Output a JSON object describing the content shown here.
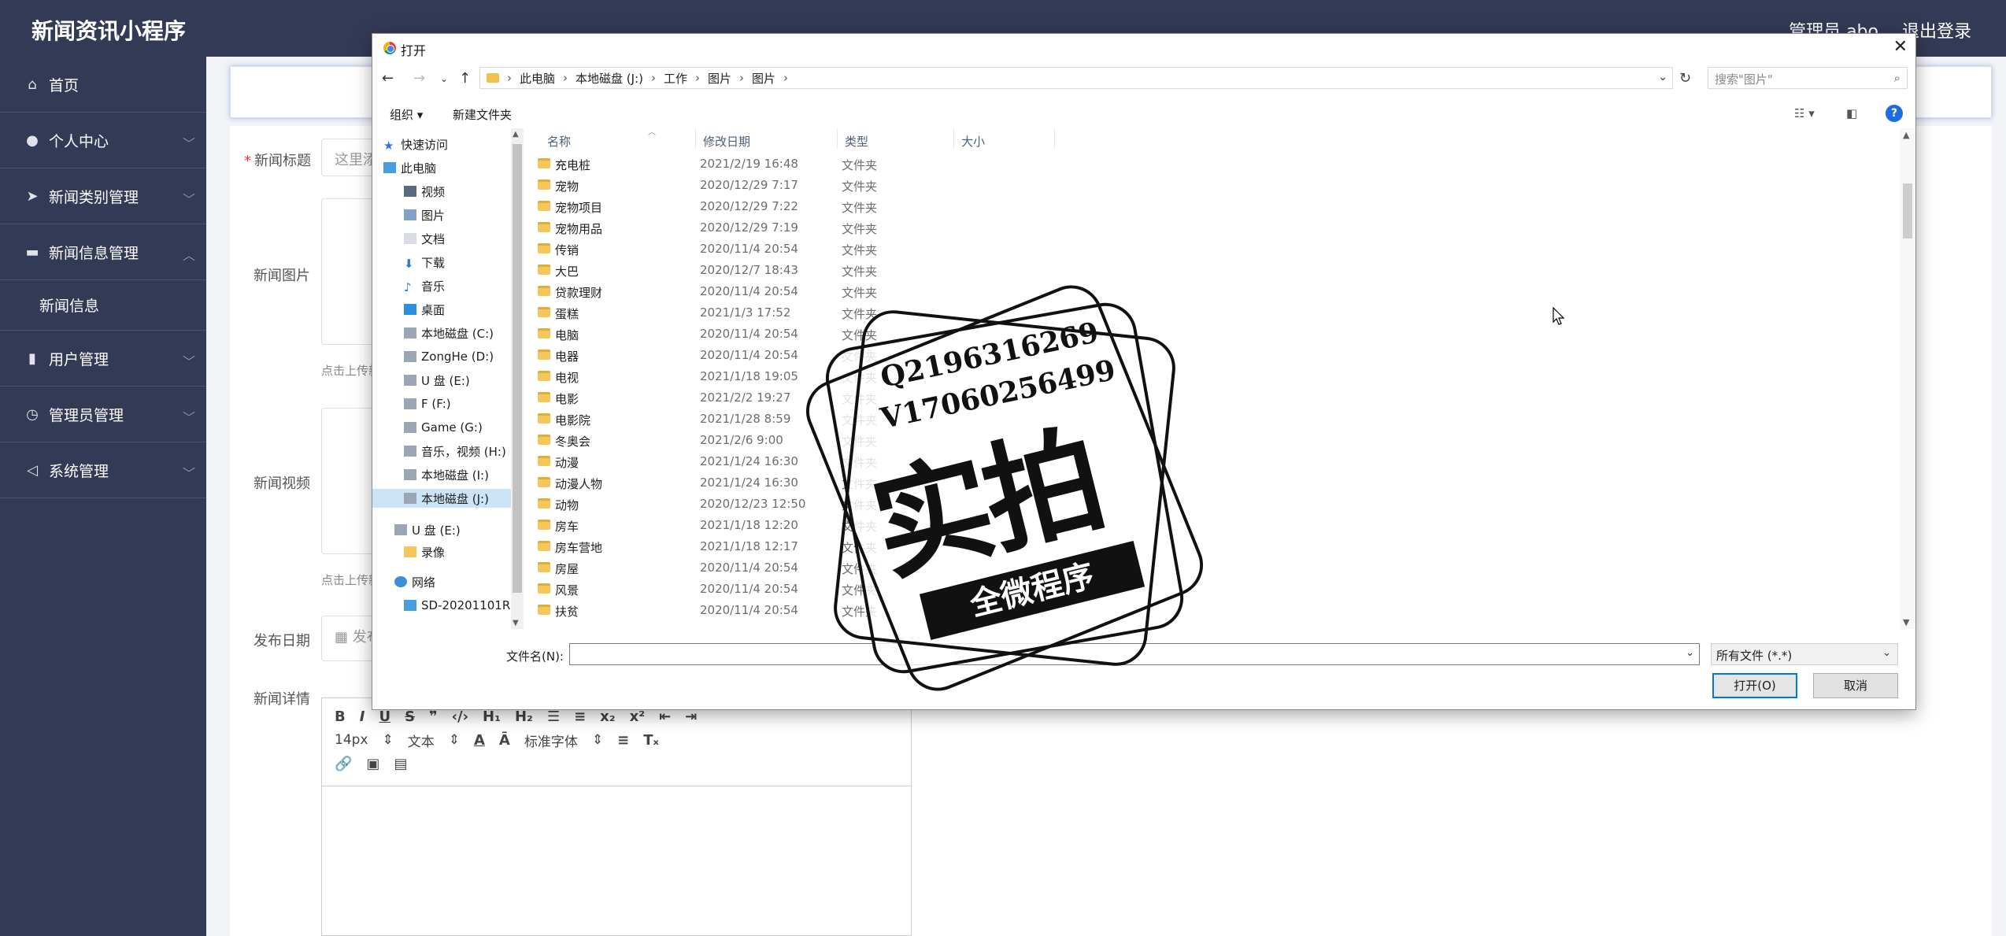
{
  "app": {
    "title": "新闻资讯小程序",
    "admin": "管理员 abo",
    "logout": "退出登录"
  },
  "sidebar": {
    "items": [
      {
        "label": "首页",
        "icon": "home-icon"
      },
      {
        "label": "个人中心",
        "icon": "user-icon"
      },
      {
        "label": "新闻类别管理",
        "icon": "send-icon"
      },
      {
        "label": "新闻信息管理",
        "icon": "monitor-icon"
      },
      {
        "label": "新闻信息",
        "icon": ""
      },
      {
        "label": "用户管理",
        "icon": "phone-icon"
      },
      {
        "label": "管理员管理",
        "icon": "clock-icon"
      },
      {
        "label": "系统管理",
        "icon": "navigate-icon"
      }
    ]
  },
  "form": {
    "title_label": "新闻标题",
    "title_placeholder": "这里添",
    "image_label": "新闻图片",
    "image_hint": "点击上传新",
    "video_label": "新闻视频",
    "video_hint": "点击上传新",
    "date_label": "发布日期",
    "date_placeholder": "发布",
    "detail_label": "新闻详情",
    "editor": {
      "font_size": "14px",
      "text_style": "文本",
      "font_family": "标准字体"
    }
  },
  "dialog": {
    "title": "打开",
    "breadcrumbs": [
      "此电脑",
      "本地磁盘 (J:)",
      "工作",
      "图片",
      "图片"
    ],
    "search_placeholder": "搜索\"图片\"",
    "toolbar": {
      "organize": "组织 ▾",
      "new_folder": "新建文件夹"
    },
    "columns": [
      "名称",
      "修改日期",
      "类型",
      "大小"
    ],
    "nav": [
      {
        "label": "快速访问",
        "icon": "star-icon",
        "indent": 0
      },
      {
        "label": "此电脑",
        "icon": "computer-icon",
        "indent": 0
      },
      {
        "label": "视频",
        "icon": "video-icon",
        "indent": 1
      },
      {
        "label": "图片",
        "icon": "picture-icon",
        "indent": 1
      },
      {
        "label": "文档",
        "icon": "document-icon",
        "indent": 1
      },
      {
        "label": "下载",
        "icon": "download-icon",
        "indent": 1
      },
      {
        "label": "音乐",
        "icon": "music-icon",
        "indent": 1
      },
      {
        "label": "桌面",
        "icon": "desktop-icon",
        "indent": 1
      },
      {
        "label": "本地磁盘 (C:)",
        "icon": "drive-icon",
        "indent": 1
      },
      {
        "label": "ZongHe (D:)",
        "icon": "drive-icon",
        "indent": 1
      },
      {
        "label": "U 盘 (E:)",
        "icon": "drive-icon",
        "indent": 1
      },
      {
        "label": "F (F:)",
        "icon": "drive-icon",
        "indent": 1
      },
      {
        "label": "Game (G:)",
        "icon": "drive-icon",
        "indent": 1
      },
      {
        "label": "音乐，视频 (H:)",
        "icon": "drive-icon",
        "indent": 1
      },
      {
        "label": "本地磁盘 (I:)",
        "icon": "drive-icon",
        "indent": 1
      },
      {
        "label": "本地磁盘 (J:)",
        "icon": "drive-icon",
        "indent": 1
      },
      {
        "label": "U 盘 (E:)",
        "icon": "drive-icon",
        "indent": 0
      },
      {
        "label": "录像",
        "icon": "folder-icon",
        "indent": 1
      },
      {
        "label": "网络",
        "icon": "network-icon",
        "indent": 0
      },
      {
        "label": "SD-20201101R",
        "icon": "computer-icon",
        "indent": 1
      }
    ],
    "files": [
      {
        "name": "充电桩",
        "date": "2021/2/19 16:48",
        "type": "文件夹"
      },
      {
        "name": "宠物",
        "date": "2020/12/29 7:17",
        "type": "文件夹"
      },
      {
        "name": "宠物项目",
        "date": "2020/12/29 7:22",
        "type": "文件夹"
      },
      {
        "name": "宠物用品",
        "date": "2020/12/29 7:19",
        "type": "文件夹"
      },
      {
        "name": "传销",
        "date": "2020/11/4 20:54",
        "type": "文件夹"
      },
      {
        "name": "大巴",
        "date": "2020/12/7 18:43",
        "type": "文件夹"
      },
      {
        "name": "贷款理财",
        "date": "2020/11/4 20:54",
        "type": "文件夹"
      },
      {
        "name": "蛋糕",
        "date": "2021/1/3 17:52",
        "type": "文件夹"
      },
      {
        "name": "电脑",
        "date": "2020/11/4 20:54",
        "type": "文件夹"
      },
      {
        "name": "电器",
        "date": "2020/11/4 20:54",
        "type": "文件夹"
      },
      {
        "name": "电视",
        "date": "2021/1/18 19:05",
        "type": "文件夹"
      },
      {
        "name": "电影",
        "date": "2021/2/2 19:27",
        "type": "文件夹"
      },
      {
        "name": "电影院",
        "date": "2021/1/28 8:59",
        "type": "文件夹"
      },
      {
        "name": "冬奥会",
        "date": "2021/2/6 9:00",
        "type": "文件夹"
      },
      {
        "name": "动漫",
        "date": "2021/1/24 16:30",
        "type": "文件夹"
      },
      {
        "name": "动漫人物",
        "date": "2021/1/24 16:30",
        "type": "文件夹"
      },
      {
        "name": "动物",
        "date": "2020/12/23 12:50",
        "type": "文件夹"
      },
      {
        "name": "房车",
        "date": "2021/1/18 12:20",
        "type": "文件夹"
      },
      {
        "name": "房车营地",
        "date": "2021/1/18 12:17",
        "type": "文件夹"
      },
      {
        "name": "房屋",
        "date": "2020/11/4 20:54",
        "type": "文件夹"
      },
      {
        "name": "风景",
        "date": "2020/11/4 20:54",
        "type": "文件夹"
      },
      {
        "name": "扶贫",
        "date": "2020/11/4 20:54",
        "type": "文件夹"
      }
    ],
    "filename_label": "文件名(N):",
    "filetype": "所有文件 (*.*)",
    "open_button": "打开(O)",
    "cancel_button": "取消"
  },
  "watermark": {
    "line1": "Q2196316269",
    "line2": "V17060256499",
    "main": "实拍",
    "ribbon": "全微程序"
  },
  "colors": {
    "sidebar_bg": "#333a55",
    "accent": "#0078d7",
    "folder": "#f3c75b"
  }
}
